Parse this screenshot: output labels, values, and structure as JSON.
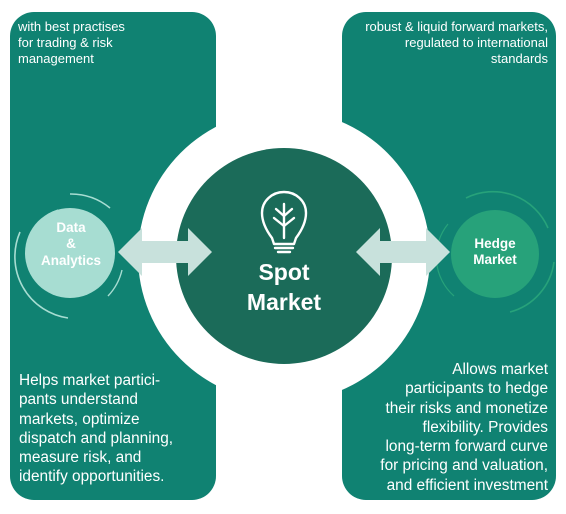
{
  "colors": {
    "panel": "#108272",
    "center": "#1b6b59",
    "data_circle": "#a7ddd2",
    "hedge_circle": "#27a27a",
    "arrow": "#c8e1dc",
    "ring": "#ffffff"
  },
  "icons": {
    "center": "lightbulb-sprout-icon"
  },
  "left_panel": {
    "top_text": "with best practises for trading & risk management",
    "bottom_text": "Helps market participants understand markets, optimize dispatch and planning, measure risk, and identify opportunities."
  },
  "right_panel": {
    "top_text": "robust & liquid forward markets, regulated to international standards",
    "bottom_text": "Allows market participants to hedge their risks and monetize flexibility. Provides long-term forward curve for pricing and valuation, and efficient investment"
  },
  "nodes": {
    "data_analytics": {
      "line1": "Data",
      "line2": "&",
      "line3": "Analytics"
    },
    "hedge_market": {
      "line1": "Hedge",
      "line2": "Market"
    },
    "spot_market": {
      "line1": "Spot",
      "line2": "Market"
    }
  }
}
